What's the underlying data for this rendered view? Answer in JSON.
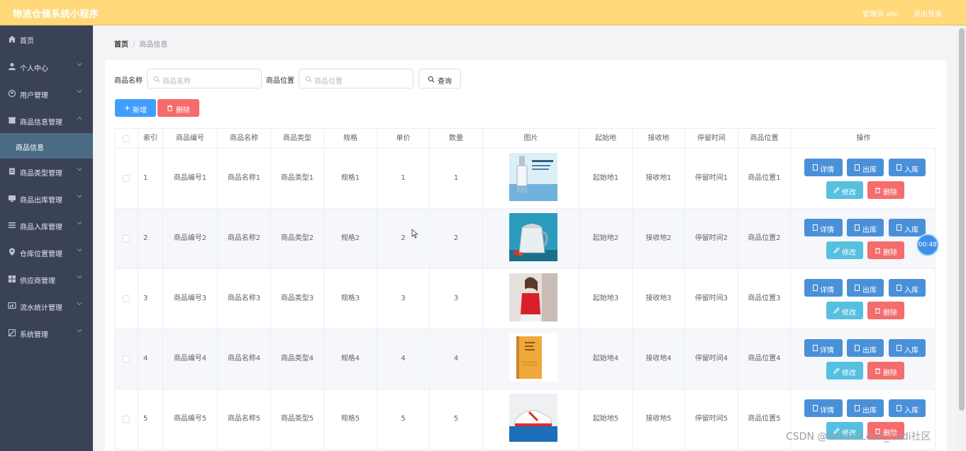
{
  "app": {
    "title": "物流仓储系统小程序",
    "admin": "管理员 abo",
    "logout": "退出登录"
  },
  "sidebar": {
    "items": [
      {
        "label": "首页",
        "icon": "home-icon"
      },
      {
        "label": "个人中心",
        "icon": "user-icon"
      },
      {
        "label": "用户管理",
        "icon": "users-icon"
      },
      {
        "label": "商品信息管理",
        "icon": "box-icon"
      },
      {
        "label": "商品信息",
        "icon": ""
      },
      {
        "label": "商品类型管理",
        "icon": "tag-icon"
      },
      {
        "label": "商品出库管理",
        "icon": "export-icon"
      },
      {
        "label": "商品入库管理",
        "icon": "import-icon"
      },
      {
        "label": "仓库位置管理",
        "icon": "location-icon"
      },
      {
        "label": "供应商管理",
        "icon": "grid-icon"
      },
      {
        "label": "流水统计管理",
        "icon": "chart-icon"
      },
      {
        "label": "系统管理",
        "icon": "settings-icon"
      }
    ]
  },
  "breadcrumb": {
    "home": "首页",
    "sep": "/",
    "current": "商品信息"
  },
  "search": {
    "name_label": "商品名称",
    "name_placeholder": "商品名称",
    "location_label": "商品位置",
    "location_placeholder": "商品位置",
    "query_label": "查询"
  },
  "toolbar": {
    "add_label": "新增",
    "delete_label": "删除"
  },
  "table": {
    "headers": [
      "索引",
      "商品编号",
      "商品名称",
      "商品类型",
      "规格",
      "单价",
      "数量",
      "图片",
      "起始地",
      "接收地",
      "停留时间",
      "商品位置",
      "操作"
    ],
    "rows": [
      {
        "index": "1",
        "code": "商品编号1",
        "name": "商品名称1",
        "type": "商品类型1",
        "spec": "规格1",
        "price": "1",
        "qty": "1",
        "origin": "起始地1",
        "dest": "接收地1",
        "stay": "停留时间1",
        "location": "商品位置1",
        "image": "serum-bottle-image"
      },
      {
        "index": "2",
        "code": "商品编号2",
        "name": "商品名称2",
        "type": "商品类型2",
        "spec": "规格2",
        "price": "2",
        "qty": "2",
        "origin": "起始地2",
        "dest": "接收地2",
        "stay": "停留时间2",
        "location": "商品位置2",
        "image": "kettle-image"
      },
      {
        "index": "3",
        "code": "商品编号3",
        "name": "商品名称3",
        "type": "商品类型3",
        "spec": "规格3",
        "price": "3",
        "qty": "3",
        "origin": "起始地3",
        "dest": "接收地3",
        "stay": "停留时间3",
        "location": "商品位置3",
        "image": "red-top-image"
      },
      {
        "index": "4",
        "code": "商品编号4",
        "name": "商品名称4",
        "type": "商品类型4",
        "spec": "规格4",
        "price": "4",
        "qty": "4",
        "origin": "起始地4",
        "dest": "接收地4",
        "stay": "停留时间4",
        "location": "商品位置4",
        "image": "book-image"
      },
      {
        "index": "5",
        "code": "商品编号5",
        "name": "商品名称5",
        "type": "商品类型5",
        "spec": "规格5",
        "price": "5",
        "qty": "5",
        "origin": "起始地5",
        "dest": "接收地5",
        "stay": "停留时间5",
        "location": "商品位置5",
        "image": "sneaker-image"
      }
    ],
    "actions": {
      "detail": "详情",
      "out": "出库",
      "in": "入库",
      "edit": "修改",
      "delete": "删除"
    }
  },
  "overlay": {
    "timer": "00:48",
    "watermark": "CSDN @DreamLove_Codi社区"
  },
  "colors": {
    "topbar": "#ffd97a",
    "sidebar": "#3a4258",
    "primary": "#409eff",
    "danger": "#f56c6c",
    "info": "#56c0e0"
  }
}
